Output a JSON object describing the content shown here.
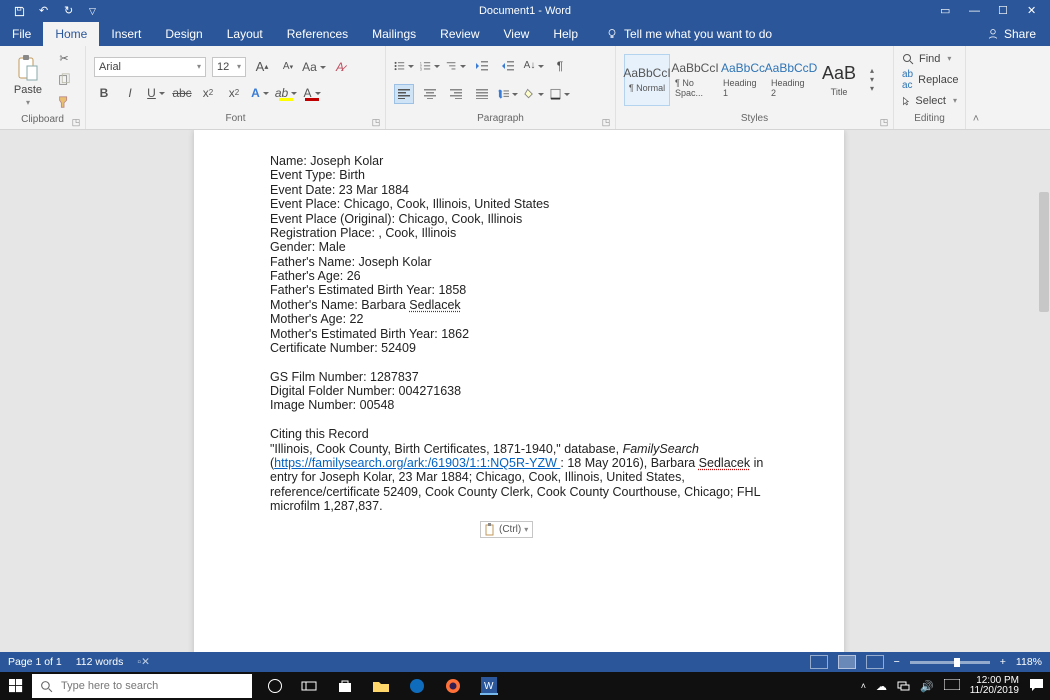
{
  "app": {
    "title": "Document1 - Word"
  },
  "tabs": {
    "file": "File",
    "home": "Home",
    "insert": "Insert",
    "design": "Design",
    "layout": "Layout",
    "references": "References",
    "mailings": "Mailings",
    "review": "Review",
    "view": "View",
    "help": "Help",
    "tellme": "Tell me what you want to do",
    "share": "Share"
  },
  "ribbon": {
    "clipboard": {
      "paste": "Paste",
      "label": "Clipboard"
    },
    "font": {
      "name": "Arial",
      "size": "12",
      "label": "Font"
    },
    "paragraph": {
      "label": "Paragraph"
    },
    "styles": {
      "label": "Styles",
      "items": [
        {
          "sample": "AaBbCcI",
          "name": "¶ Normal"
        },
        {
          "sample": "AaBbCcI",
          "name": "¶ No Spac..."
        },
        {
          "sample": "AaBbCc",
          "name": "Heading 1"
        },
        {
          "sample": "AaBbCcD",
          "name": "Heading 2"
        },
        {
          "sample": "AaB",
          "name": "Title"
        }
      ]
    },
    "editing": {
      "find": "Find",
      "replace": "Replace",
      "select": "Select",
      "label": "Editing"
    }
  },
  "document": {
    "lines": [
      "Name: Joseph Kolar",
      "Event Type: Birth",
      "Event Date: 23 Mar 1884",
      "Event Place: Chicago, Cook, Illinois, United States",
      "Event Place (Original): Chicago, Cook, Illinois",
      "Registration Place: , Cook, Illinois",
      "Gender: Male",
      "Father's Name: Joseph Kolar",
      "Father's Age: 26",
      "Father's Estimated Birth Year: 1858"
    ],
    "mother_name_prefix": "Mother's Name: Barbara ",
    "mother_name_surname": "Sedlacek",
    "lines2": [
      "Mother's Age: 22",
      "Mother's Estimated Birth Year: 1862",
      "Certificate Number: 52409"
    ],
    "lines3": [
      "GS Film Number: 1287837",
      "Digital Folder Number: 004271638",
      "Image Number: 00548"
    ],
    "citing_header": "Citing this Record",
    "cite_1": "\"Illinois, Cook County, Birth Certificates, 1871-1940,\" database, ",
    "cite_italic": "FamilySearch",
    "cite_link": "https://familysearch.org/ark:/61903/1:1:NQ5R-YZW ",
    "cite_after_link": ": 18 May 2016), Barbara ",
    "cite_surname": "Sedlacek",
    "cite_tail": " in entry for Joseph Kolar, 23 Mar 1884; Chicago, Cook, Illinois, United States, reference/certificate 52409, Cook County Clerk, Cook County Courthouse, Chicago; FHL microfilm 1,287,837.",
    "paste_opts": "(Ctrl)"
  },
  "status": {
    "page": "Page 1 of 1",
    "words": "112 words",
    "zoom": "118%"
  },
  "taskbar": {
    "search_placeholder": "Type here to search",
    "time": "12:00 PM",
    "date": "11/20/2019"
  }
}
